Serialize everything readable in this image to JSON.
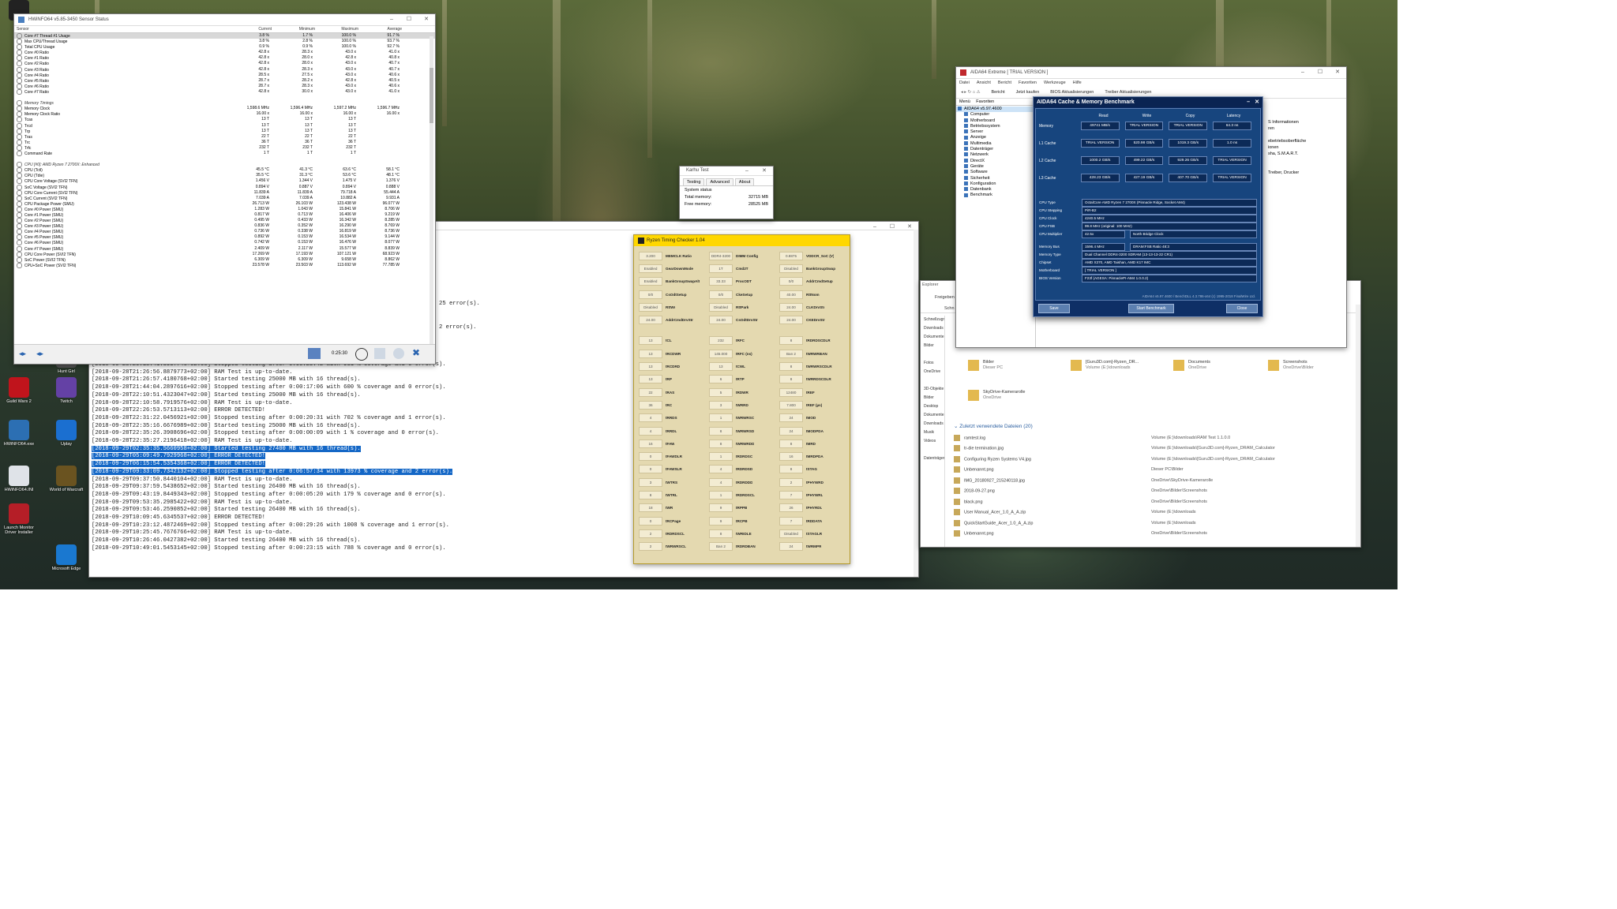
{
  "hwinfo": {
    "title": "HWiNFO64 v5.85-3450 Sensor Status",
    "columns": [
      "Sensor",
      "Current",
      "Minimum",
      "Maximum",
      "Average"
    ],
    "rows": [
      {
        "n": "Core #7 Thread #1 Usage",
        "c": "3.8 %",
        "mi": "1.7 %",
        "ma": "100.0 %",
        "av": "91.7 %"
      },
      {
        "n": "Max CPU/Thread Usage",
        "c": "3.8 %",
        "mi": "2.8 %",
        "ma": "100.0 %",
        "av": "93.7 %"
      },
      {
        "n": "Total CPU Usage",
        "c": "0.9 %",
        "mi": "0.9 %",
        "ma": "100.0 %",
        "av": "92.7 %"
      },
      {
        "n": "Core #0 Ratio",
        "c": "42.8 x",
        "mi": "28.3 x",
        "ma": "43.0 x",
        "av": "41.0 x"
      },
      {
        "n": "Core #1 Ratio",
        "c": "42.8 x",
        "mi": "28.0 x",
        "ma": "42.8 x",
        "av": "40.8 x"
      },
      {
        "n": "Core #2 Ratio",
        "c": "42.8 x",
        "mi": "28.0 x",
        "ma": "43.0 x",
        "av": "40.7 x"
      },
      {
        "n": "Core #3 Ratio",
        "c": "42.8 x",
        "mi": "28.3 x",
        "ma": "43.0 x",
        "av": "40.7 x"
      },
      {
        "n": "Core #4 Ratio",
        "c": "28.5 x",
        "mi": "27.5 x",
        "ma": "43.0 x",
        "av": "40.6 x"
      },
      {
        "n": "Core #5 Ratio",
        "c": "28.7 x",
        "mi": "28.2 x",
        "ma": "42.8 x",
        "av": "40.5 x"
      },
      {
        "n": "Core #6 Ratio",
        "c": "28.7 x",
        "mi": "28.3 x",
        "ma": "43.0 x",
        "av": "40.6 x"
      },
      {
        "n": "Core #7 Ratio",
        "c": "42.8 x",
        "mi": "30.0 x",
        "ma": "43.0 x",
        "av": "41.0 x"
      },
      {
        "n": "",
        "c": "",
        "mi": "",
        "ma": "",
        "av": ""
      },
      {
        "n": "Memory Timings",
        "c": "",
        "mi": "",
        "ma": "",
        "av": "",
        "grp": true
      },
      {
        "n": "Memory Clock",
        "c": "1,598.6 MHz",
        "mi": "1,596.4 MHz",
        "ma": "1,597.2 MHz",
        "av": "1,596.7 MHz"
      },
      {
        "n": "Memory Clock Ratio",
        "c": "16.00 x",
        "mi": "16.00 x",
        "ma": "16.00 x",
        "av": "16.00 x"
      },
      {
        "n": "Tcas",
        "c": "13 T",
        "mi": "13 T",
        "ma": "13 T",
        "av": ""
      },
      {
        "n": "Trcd",
        "c": "13 T",
        "mi": "13 T",
        "ma": "13 T",
        "av": ""
      },
      {
        "n": "Trp",
        "c": "13 T",
        "mi": "13 T",
        "ma": "13 T",
        "av": ""
      },
      {
        "n": "Tras",
        "c": "22 T",
        "mi": "22 T",
        "ma": "22 T",
        "av": ""
      },
      {
        "n": "Trc",
        "c": "36 T",
        "mi": "36 T",
        "ma": "36 T",
        "av": ""
      },
      {
        "n": "Trfc",
        "c": "232 T",
        "mi": "232 T",
        "ma": "232 T",
        "av": ""
      },
      {
        "n": "Command Rate",
        "c": "1 T",
        "mi": "1 T",
        "ma": "1 T",
        "av": ""
      },
      {
        "n": "",
        "c": "",
        "mi": "",
        "ma": "",
        "av": ""
      },
      {
        "n": "CPU [#0]: AMD Ryzen 7 2700X: Enhanced",
        "c": "",
        "mi": "",
        "ma": "",
        "av": "",
        "grp": true
      },
      {
        "n": "CPU (Tctl)",
        "c": "45.5 °C",
        "mi": "41.3 °C",
        "ma": "63.6 °C",
        "av": "58.1 °C"
      },
      {
        "n": "CPU (Tdie)",
        "c": "35.5 °C",
        "mi": "31.3 °C",
        "ma": "53.6 °C",
        "av": "48.1 °C"
      },
      {
        "n": "CPU Core Voltage (SVI2 TFN)",
        "c": "1.456 V",
        "mi": "1.344 V",
        "ma": "1.475 V",
        "av": "1.376 V"
      },
      {
        "n": "SoC Voltage (SVI2 TFN)",
        "c": "0.894 V",
        "mi": "0.887 V",
        "ma": "0.894 V",
        "av": "0.888 V"
      },
      {
        "n": "CPU Core Current (SVI2 TFN)",
        "c": "11.839 A",
        "mi": "11.839 A",
        "ma": "79.718 A",
        "av": "55.444 A"
      },
      {
        "n": "SoC Current (SVI2 TFN)",
        "c": "7.039 A",
        "mi": "7.039 A",
        "ma": "10.882 A",
        "av": "9.931 A"
      },
      {
        "n": "CPU Package Power (SMU)",
        "c": "26.713 W",
        "mi": "26.103 W",
        "ma": "123.438 W",
        "av": "96.077 W"
      },
      {
        "n": "Core #0 Power (SMU)",
        "c": "1.283 W",
        "mi": "1.043 W",
        "ma": "15.841 W",
        "av": "8.706 W"
      },
      {
        "n": "Core #1 Power (SMU)",
        "c": "0.817 W",
        "mi": "0.713 W",
        "ma": "16.406 W",
        "av": "9.219 W"
      },
      {
        "n": "Core #2 Power (SMU)",
        "c": "0.495 W",
        "mi": "0.433 W",
        "ma": "16.342 W",
        "av": "8.285 W"
      },
      {
        "n": "Core #3 Power (SMU)",
        "c": "0.836 W",
        "mi": "0.352 W",
        "ma": "16.290 W",
        "av": "8.769 W"
      },
      {
        "n": "Core #4 Power (SMU)",
        "c": "0.736 W",
        "mi": "0.338 W",
        "ma": "16.819 W",
        "av": "8.736 W"
      },
      {
        "n": "Core #5 Power (SMU)",
        "c": "0.892 W",
        "mi": "0.153 W",
        "ma": "16.534 W",
        "av": "9.144 W"
      },
      {
        "n": "Core #6 Power (SMU)",
        "c": "0.742 W",
        "mi": "0.153 W",
        "ma": "16.476 W",
        "av": "8.077 W"
      },
      {
        "n": "Core #7 Power (SMU)",
        "c": "2.409 W",
        "mi": "2.117 W",
        "ma": "15.577 W",
        "av": "8.839 W"
      },
      {
        "n": "CPU Core Power (SVI2 TFN)",
        "c": "17.269 W",
        "mi": "17.193 W",
        "ma": "107.121 W",
        "av": "68.923 W"
      },
      {
        "n": "SoC Power (SVI2 TFN)",
        "c": "6.309 W",
        "mi": "6.309 W",
        "ma": "9.658 W",
        "av": "8.862 W"
      },
      {
        "n": "CPU+SoC Power (SVI2 TFN)",
        "c": "23.578 W",
        "mi": "23.503 W",
        "ma": "113.692 W",
        "av": "77.785 W"
      }
    ],
    "timer": "0:25:30"
  },
  "console": {
    "partial_top": [
      "25 error(s).",
      "",
      "",
      "",
      "2 error(s)."
    ],
    "lines": [
      {
        "t": "[2018-09-28T20:18:41.3037746+02:00] Stopped testing after 0:00:25:42 with 931 % coverage and 0 error(s)."
      },
      {
        "t": "[2018-09-28T21:26:56.8879773+02:00] RAM Test is up-to-date."
      },
      {
        "t": "[2018-09-28T21:26:57.4180768+02:00] Started testing 25000 MB with 16 thread(s)."
      },
      {
        "t": "[2018-09-28T21:44:04.2897616+02:00] Stopped testing after 0:00:17:06 with 600 % coverage and 0 error(s)."
      },
      {
        "t": "[2018-09-28T22:10:51.4323047+02:00] Started testing 25000 MB with 16 thread(s)."
      },
      {
        "t": "[2018-09-28T22:10:58.7919576+02:00] RAM Test is up-to-date."
      },
      {
        "t": "[2018-09-28T22:26:53.5713113+02:00] ERROR DETECTED!"
      },
      {
        "t": "[2018-09-28T22:31:22.0456921+02:00] Stopped testing after 0:00:20:31 with 702 % coverage and 1 error(s)."
      },
      {
        "t": "[2018-09-28T22:35:16.6676989+02:00] Started testing 25000 MB with 16 thread(s)."
      },
      {
        "t": "[2018-09-28T22:35:26.3908696+02:00] Stopped testing after 0:00:00:09 with 1 % coverage and 0 error(s)."
      },
      {
        "t": "[2018-09-28T22:35:27.2196418+02:00] RAM Test is up-to-date."
      },
      {
        "t": "[2018-09-29T02:35:35.5660958+02:00] Started testing 27400 MB with 16 thread(s).",
        "hl": true
      },
      {
        "t": "[2018-09-29T05:09:49.7929968+02:00] ERROR DETECTED!",
        "hl": true
      },
      {
        "t": "[2018-09-29T06:15:54.5354368+02:00] ERROR DETECTED!",
        "hl": true
      },
      {
        "t": "[2018-09-29T09:33:09.7342132+02:00] Stopped testing after 0:06:57:34 with 13973 % coverage and 2 error(s).",
        "hl": true
      },
      {
        "t": "[2018-09-29T09:37:50.8440104+02:00] RAM Test is up-to-date."
      },
      {
        "t": "[2018-09-29T09:37:59.5438652+02:00] Started testing 26400 MB with 16 thread(s)."
      },
      {
        "t": "[2018-09-29T09:43:19.8449343+02:00] Stopped testing after 0:00:05:20 with 179 % coverage and 0 error(s)."
      },
      {
        "t": "[2018-09-29T09:53:35.2985422+02:00] RAM Test is up-to-date."
      },
      {
        "t": "[2018-09-29T09:53:46.2590852+02:00] Started testing 26400 MB with 16 thread(s)."
      },
      {
        "t": "[2018-09-29T10:09:45.6345537+02:00] ERROR DETECTED!"
      },
      {
        "t": "[2018-09-29T10:23:12.4872469+02:00] Stopped testing after 0:00:29:26 with 1008 % coverage and 1 error(s)."
      },
      {
        "t": "[2018-09-29T10:25:45.7676766+02:00] RAM Test is up-to-date."
      },
      {
        "t": "[2018-09-29T10:26:46.0427382+02:00] Started testing 26400 MB with 16 thread(s)."
      },
      {
        "t": "[2018-09-29T10:49:01.5453145+02:00] Stopped testing after 0:00:23:15 with 788 % coverage and 0 error(s)."
      }
    ]
  },
  "karhu": {
    "title": "Karhu Test",
    "tabs": [
      "Testing",
      "Advanced",
      "About"
    ],
    "section": "System status",
    "total_label": "Total memory:",
    "total": "32715 MB",
    "free_label": "Free memory:",
    "free": "28525 MB"
  },
  "ryzen": {
    "title": "Ryzen Timing Checker 1.04",
    "top": [
      [
        "3.200",
        "MEMCLK Ratio"
      ],
      [
        "DDR4-3200",
        "DIMM Config"
      ],
      [
        "0.8875",
        "VDDCR_SoC (V)"
      ],
      [
        "Enabled",
        "GearDownMode"
      ],
      [
        "1T",
        "Cmd2T"
      ],
      [
        "Disabled",
        "BankGroupSwap"
      ],
      [
        "Enabled",
        "BankGroupSwapAlt"
      ],
      [
        "33.33",
        "ProcODT"
      ],
      [
        "0/0",
        "AddrCmdSetup"
      ],
      [
        "0/0",
        "CsOdtSetup"
      ],
      [
        "0/0",
        "CkeSetup"
      ],
      [
        "40.00",
        "RttNom"
      ],
      [
        "Disabled",
        "RttWr"
      ],
      [
        "Disabled",
        "RttPark"
      ],
      [
        "24.00",
        "CLKDrvStr"
      ],
      [
        "24.00",
        "AddrCmdDrvStr"
      ],
      [
        "24.00",
        "CsOdtDrvStr"
      ],
      [
        "24.00",
        "CKEDrvStr"
      ]
    ],
    "bottom": [
      [
        "13",
        "tCL"
      ],
      [
        "232",
        "tRFC"
      ],
      [
        "8",
        "tRDRDSCDLR"
      ],
      [
        "13",
        "tRCDWR"
      ],
      [
        "145.000",
        "tRFC (ns)"
      ],
      [
        "Ban 2",
        "tWRWRBAN"
      ],
      [
        "13",
        "tRCDRD"
      ],
      [
        "13",
        "tCWL"
      ],
      [
        "8",
        "tWRWRSCDLR"
      ],
      [
        "13",
        "tRP"
      ],
      [
        "6",
        "tRTP"
      ],
      [
        "8",
        "tWRRDSCDLR"
      ],
      [
        "22",
        "tRAS"
      ],
      [
        "5",
        "tRDWR"
      ],
      [
        "12480",
        "tREF"
      ],
      [
        "36",
        "tRC"
      ],
      [
        "3",
        "tWRRD"
      ],
      [
        "7.800",
        "tREF (µs)"
      ],
      [
        "4",
        "tRRDS"
      ],
      [
        "1",
        "tWRWRSC"
      ],
      [
        "24",
        "tMOD"
      ],
      [
        "4",
        "tRRDL"
      ],
      [
        "8",
        "tWRWRSD"
      ],
      [
        "24",
        "tMODPDA"
      ],
      [
        "16",
        "tFAW"
      ],
      [
        "8",
        "tWRWRDD"
      ],
      [
        "8",
        "tMRD"
      ],
      [
        "0",
        "tFAWDLR"
      ],
      [
        "1",
        "tRDRDSC"
      ],
      [
        "16",
        "tMRDPDA"
      ],
      [
        "0",
        "tFAWSLR"
      ],
      [
        "4",
        "tRDRDSD"
      ],
      [
        "8",
        "tSTAG"
      ],
      [
        "3",
        "tWTRS"
      ],
      [
        "4",
        "tRDRDDD"
      ],
      [
        "2",
        "tPHYWRD"
      ],
      [
        "8",
        "tWTRL"
      ],
      [
        "1",
        "tRDRDSCL"
      ],
      [
        "7",
        "tPHYWRL"
      ],
      [
        "18",
        "tWR"
      ],
      [
        "9",
        "tRPPB"
      ],
      [
        "26",
        "tPHYRDL"
      ],
      [
        "0",
        "tRCPage"
      ],
      [
        "9",
        "tRCPB"
      ],
      [
        "7",
        "tRDDATA"
      ],
      [
        "2",
        "tRDRDSCL"
      ],
      [
        "8",
        "tWRIDLE"
      ],
      [
        "Disabled",
        "tSTAGLR"
      ],
      [
        "2",
        "tWRWRSCL"
      ],
      [
        "Ban 2",
        "tRDRDBAN"
      ],
      [
        "24",
        "tWRMPR"
      ]
    ]
  },
  "aida": {
    "title": "AIDA64 Extreme [ TRIAL VERSION ]",
    "menu": [
      "Datei",
      "Ansicht",
      "Bericht",
      "Favoriten",
      "Werkzeuge",
      "Hilfe"
    ],
    "tools": [
      "Bericht",
      "Jetzt kaufen",
      "BIOS Aktualisierungen",
      "Treiber Aktualisierungen"
    ],
    "panel_tabs": [
      "Menü",
      "Favoriten"
    ],
    "tree": [
      "AIDA64 v5.97.4600",
      "Computer",
      "Motherboard",
      "Betriebssystem",
      "Server",
      "Anzeige",
      "Multimedia",
      "Datenträger",
      "Netzwerk",
      "DirectX",
      "Geräte",
      "Software",
      "Sicherheit",
      "Konfiguration",
      "Datenbank",
      "Benchmark"
    ],
    "right_items": [
      "S Informationen",
      "ren",
      "",
      "ebetriebsoberfläche",
      "ionen",
      "sha, S.M.A.R.T.",
      "",
      "",
      "Treiber, Drucker"
    ]
  },
  "bench": {
    "title": "AIDA64 Cache & Memory Benchmark",
    "headers": [
      "Read",
      "Write",
      "Copy",
      "Latency"
    ],
    "rows": [
      {
        "label": "Memory",
        "v": [
          "49741 MB/s",
          "TRIAL VERSION",
          "TRIAL VERSION",
          "64.3 ns"
        ]
      },
      {
        "label": "L1 Cache",
        "v": [
          "TRIAL VERSION",
          "520.98 GB/s",
          "1019.3 GB/s",
          "1.0 ns"
        ]
      },
      {
        "label": "L2 Cache",
        "v": [
          "1000.2 GB/s",
          "499.22 GB/s",
          "929.26 GB/s",
          "TRIAL VERSION"
        ]
      },
      {
        "label": "L3 Cache",
        "v": [
          "428.23 GB/s",
          "427.19 GB/s",
          "407.70 GB/s",
          "TRIAL VERSION"
        ]
      }
    ],
    "info": [
      {
        "label": "CPU Type",
        "value": "OctalCore AMD Ryzen 7 2700X (Pinnacle Ridge, Socket AM4)"
      },
      {
        "label": "CPU Stepping",
        "value": "PiR-B2"
      },
      {
        "label": "CPU Clock",
        "value": "4240.5 MHz"
      },
      {
        "label": "CPU FSB",
        "value": "99.8 MHz (original: 100 MHz)"
      },
      {
        "label": "CPU Multiplier",
        "value": "42.5x",
        "extra": "North Bridge Clock"
      },
      {
        "label": "Memory Bus",
        "value": "1596.4 MHz",
        "extra": "DRAM:FSB Ratio   48:3"
      },
      {
        "label": "Memory Type",
        "value": "Dual Channel DDR4-3200 SDRAM (13-13-13-22 CR1)"
      },
      {
        "label": "Chipset",
        "value": "AMD X370, AMD Taishan, AMD K17 IMC"
      },
      {
        "label": "Motherboard",
        "value": "[ TRIAL VERSION ]"
      },
      {
        "label": "BIOS Version",
        "value": "F23f (AGESA: PinnaclePI-AM4 1.0.0.2)"
      }
    ],
    "footer": "AIDA64 v5.97.4600 / BenchDLL 4.3.786-x64   (c) 1995-2018 FinalWire Ltd.",
    "save": "Save",
    "start": "Start Benchmark",
    "close": "Close"
  },
  "explorer": {
    "tab": "Explorer",
    "ribbon": "Freigeben",
    "address": "Schn",
    "sidebar": [
      "Schnellzugriff",
      "Downloads",
      "Dokumente",
      "Bilder",
      "",
      "Fotos",
      "OneDrive",
      "",
      "3D-Objekte",
      "Bilder",
      "Desktop",
      "Dokumente",
      "Downloads",
      "Musik",
      "Videos",
      "",
      "Datenträger"
    ],
    "quick": [
      {
        "name": "Bilder",
        "loc": "Dieser PC"
      },
      {
        "name": "[Guru3D.com]-Ryzen_DR...",
        "loc": "Volume (E:)\\downloads"
      },
      {
        "name": "Documents",
        "loc": "OneDrive"
      },
      {
        "name": "Screenshots",
        "loc": "OneDrive\\Bilder"
      },
      {
        "name": "SkyDrive-Kamerarolle",
        "loc": "OneDrive"
      }
    ],
    "recent_title": "Zuletzt verwendete Dateien (20)",
    "recent": [
      {
        "n": "ramtest.log",
        "l": "Volume (E:)\\downloads\\RAM Test 1.1.0.0"
      },
      {
        "n": "tr-die termination.jpg",
        "l": "Volume (E:)\\downloads\\[Guru3D.com]-Ryzen_DRAM_Calculator"
      },
      {
        "n": "Configuring Ryzen Systems V4.jpg",
        "l": "Volume (E:)\\downloads\\[Guru3D.com]-Ryzen_DRAM_Calculator"
      },
      {
        "n": "Unbenannt.png",
        "l": "Dieser PC\\Bilder"
      },
      {
        "n": "IMG_20180927_215240118.jpg",
        "l": "OneDrive\\SkyDrive-Kamerarolle"
      },
      {
        "n": "2018-09-27.png",
        "l": "OneDrive\\Bilder\\Screenshots"
      },
      {
        "n": "black.png",
        "l": "OneDrive\\Bilder\\Screenshots"
      },
      {
        "n": "User Manual_Acer_1.0_A_A.zip",
        "l": "Volume (E:)\\downloads"
      },
      {
        "n": "QuickStartGuide_Acer_1.0_A_A.zip",
        "l": "Volume (E:)\\downloads"
      },
      {
        "n": "Unbenannt.png",
        "l": "OneDrive\\Bilder\\Screenshots"
      }
    ]
  },
  "desktop": {
    "icons": [
      {
        "label": "MIO",
        "color": "#222"
      },
      {
        "label": "Hunt Girl",
        "color": "#555"
      },
      {
        "label": "Guild Wars 2",
        "color": "#c0141c"
      },
      {
        "label": "Twitch",
        "color": "#6441a5"
      },
      {
        "label": "HWiNFO64.exe",
        "color": "#2c6fb3"
      },
      {
        "label": "Uplay",
        "color": "#1b6fd0"
      },
      {
        "label": "HWiNFO64.INI",
        "color": "#dfe3e8"
      },
      {
        "label": "World of Warcraft",
        "color": "#6a5320"
      },
      {
        "label": "Launch Monitor Driver Installer",
        "color": "#b51e27"
      },
      {
        "label": "Microsoft Edge",
        "color": "#1a78d0"
      }
    ]
  }
}
